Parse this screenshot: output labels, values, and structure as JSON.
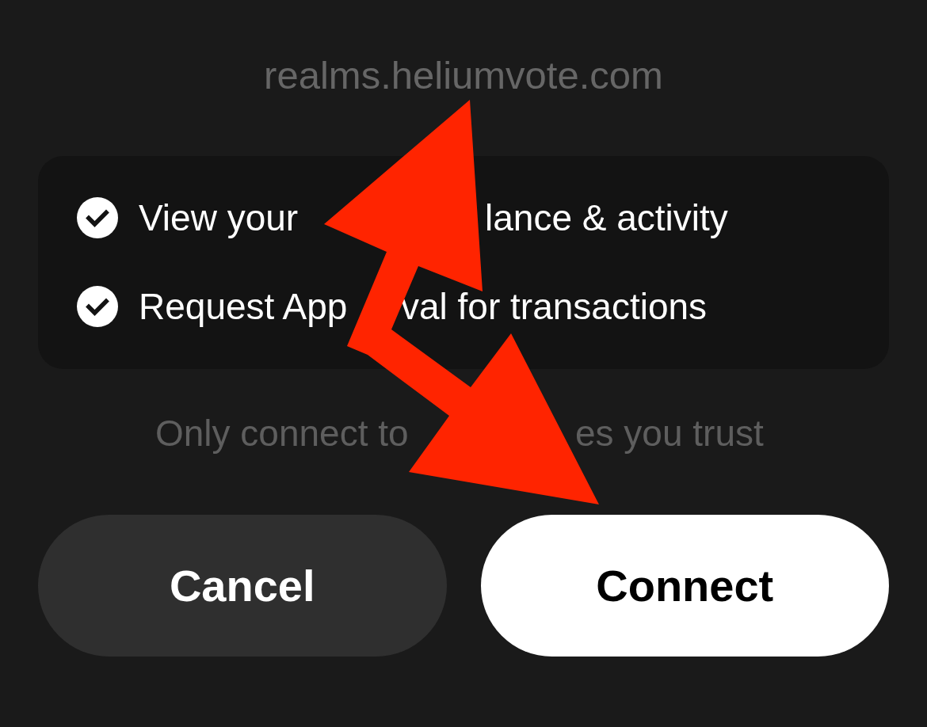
{
  "site": {
    "url": "realms.heliumvote.com"
  },
  "permissions": [
    {
      "parts": [
        "View your",
        "lance & activity"
      ],
      "checked": true
    },
    {
      "parts": [
        "Request App",
        "val for transactions"
      ],
      "checked": true
    }
  ],
  "notice": {
    "parts": [
      "Only connect to",
      "es you trust"
    ]
  },
  "buttons": [
    {
      "label": "Cancel",
      "kind": "secondary"
    },
    {
      "label": "Connect",
      "kind": "primary"
    }
  ]
}
